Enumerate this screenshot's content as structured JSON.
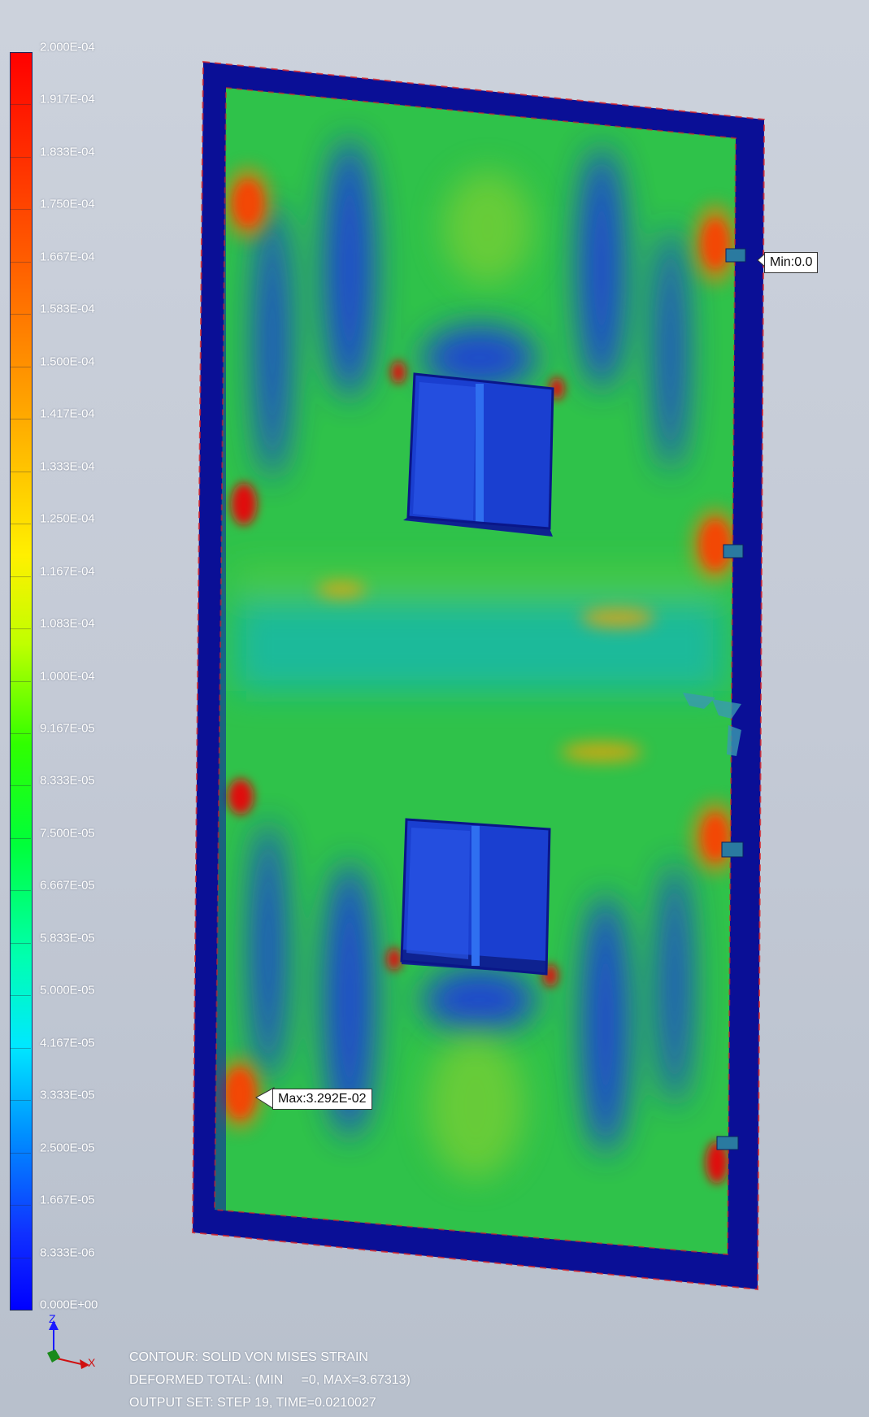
{
  "legend": {
    "ticks": [
      "2.000E-04",
      "1.917E-04",
      "1.833E-04",
      "1.750E-04",
      "1.667E-04",
      "1.583E-04",
      "1.500E-04",
      "1.417E-04",
      "1.333E-04",
      "1.250E-04",
      "1.167E-04",
      "1.083E-04",
      "1.000E-04",
      "9.167E-05",
      "8.333E-05",
      "7.500E-05",
      "6.667E-05",
      "5.833E-05",
      "5.000E-05",
      "4.167E-05",
      "3.333E-05",
      "2.500E-05",
      "1.667E-05",
      "8.333E-06",
      "0.000E+00"
    ],
    "colors": {
      "max": "#ff0000",
      "mid": "#30ff00",
      "min": "#0000ff"
    }
  },
  "callouts": {
    "min_label": "Min:0.0",
    "max_label": "Max:3.292E-02"
  },
  "triad": {
    "z": "Z",
    "x": "X"
  },
  "info": {
    "line1": "CONTOUR: SOLID VON MISES STRAIN",
    "line2": "DEFORMED TOTAL: (MIN     =0, MAX=3.67313)",
    "line3": "OUTPUT SET: STEP 19, TIME=0.0210027"
  },
  "colors": {
    "frame_blue": "#0a0f96",
    "field_green": "#33c44a",
    "panel_blue": "#1a3fd0",
    "hot_red": "#e01010"
  }
}
